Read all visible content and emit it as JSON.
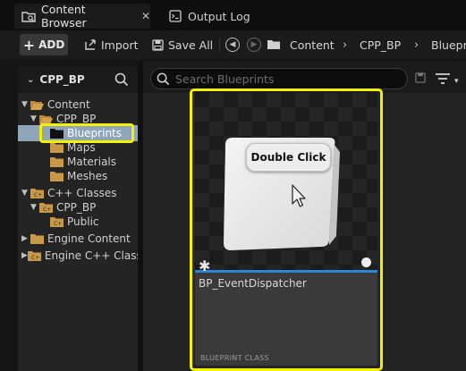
{
  "tabs": [
    {
      "label": "Content Browser",
      "icon": "content-browser-icon",
      "active": true
    },
    {
      "label": "Output Log",
      "icon": "output-log-icon",
      "active": false
    }
  ],
  "toolbar": {
    "add_label": "ADD",
    "import_label": "Import",
    "save_all_label": "Save All"
  },
  "breadcrumb": [
    "Content",
    "CPP_BP",
    "Blueprin"
  ],
  "left_panel": {
    "title": "CPP_BP",
    "tree": [
      {
        "label": "Content",
        "expanded": true
      },
      {
        "label": "CPP_BP",
        "expanded": true
      },
      {
        "label": "Blueprints",
        "selected": true
      },
      {
        "label": "Maps"
      },
      {
        "label": "Materials"
      },
      {
        "label": "Meshes"
      },
      {
        "label": "C++ Classes",
        "expanded": true
      },
      {
        "label": "CPP_BP",
        "expanded": true
      },
      {
        "label": "Public"
      },
      {
        "label": "Engine Content",
        "expanded": false
      },
      {
        "label": "Engine C++ Classes",
        "expanded": false
      }
    ]
  },
  "search": {
    "placeholder": "Search Blueprints"
  },
  "asset": {
    "name": "BP_EventDispatcher",
    "type": "BLUEPRINT CLASS",
    "tooltip": "Double Click"
  },
  "colors": {
    "highlight": "#f2f200",
    "selection": "#8fa6ba",
    "accent_line": "#2f86d6",
    "folder": "#c79a4a"
  }
}
